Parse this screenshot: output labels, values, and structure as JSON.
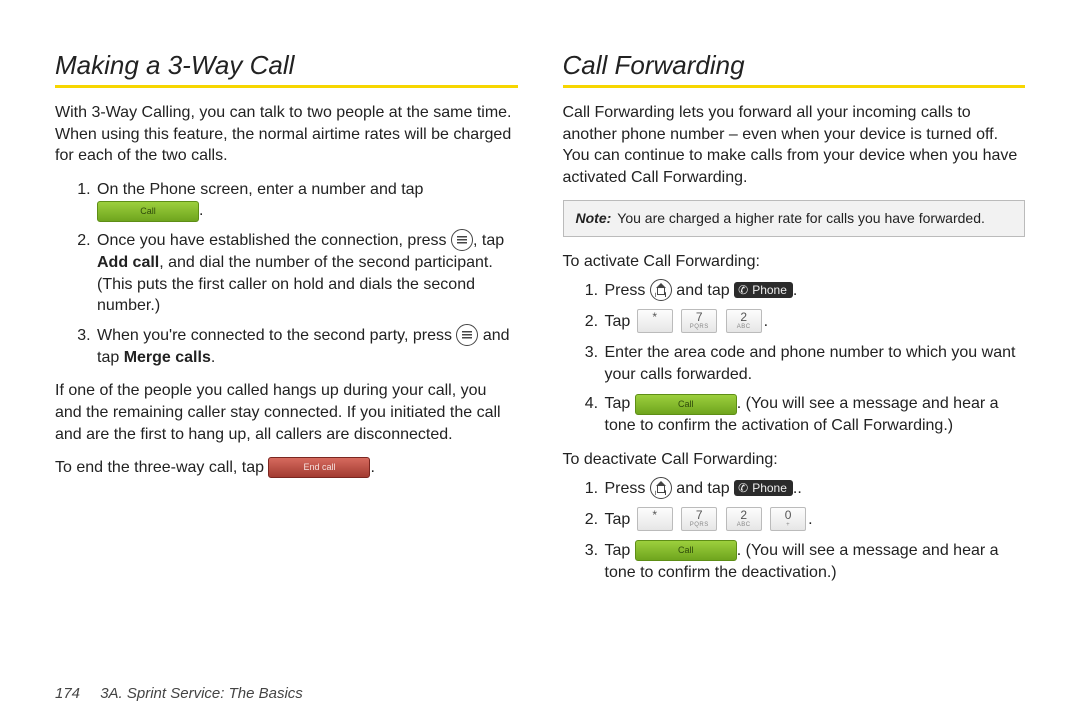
{
  "left": {
    "heading": "Making a 3-Way Call",
    "intro": "With 3-Way Calling, you can talk to two people at the same time. When using this feature, the normal airtime rates will be charged for each of the two calls.",
    "steps": {
      "s1a": "On the Phone screen, enter a number and tap ",
      "s1_btn": "Call",
      "s2a": "Once you have established the connection, press ",
      "s2b": ", tap ",
      "s2_bold": "Add call",
      "s2c": ", and dial the number of the second participant. (This puts the first caller on hold and dials the second number.)",
      "s3a": "When you're connected to the second party, press ",
      "s3b": " and tap ",
      "s3_bold": "Merge calls",
      "s3c": "."
    },
    "after": "If one of the people you called hangs up during your call, you and the remaining caller stay connected. If you initiated the call and are the first to hang up, all callers are disconnected.",
    "end_a": "To end the three-way call, tap ",
    "end_btn": "End call",
    "end_b": "."
  },
  "right": {
    "heading": "Call Forwarding",
    "intro": "Call Forwarding lets you forward all your incoming calls to another phone number – even when your device is turned off. You can continue to make calls from your device when you have activated Call Forwarding.",
    "note_label": "Note:",
    "note_text": "You are charged a higher rate for calls you have forwarded.",
    "activate_head": "To activate Call Forwarding:",
    "act": {
      "s1a": "Press ",
      "s1b": " and tap ",
      "phone_label": "Phone",
      "s1c": ".",
      "s2a": "Tap ",
      "s2b": ".",
      "s3": "Enter the area code and phone number to which you want your calls forwarded.",
      "s4a": "Tap ",
      "s4_btn": "Call",
      "s4b": ". (You will see a message and hear a tone to confirm the activation of Call Forwarding.)"
    },
    "deactivate_head": "To deactivate Call Forwarding:",
    "deact": {
      "s1a": "Press ",
      "s1b": " and tap ",
      "s1c": "..",
      "s2a": "Tap ",
      "s2b": ".",
      "s3a": "Tap ",
      "s3_btn": "Call",
      "s3b": ". (You will see a message and hear a tone to confirm the deactivation.)"
    },
    "keys_activate": [
      {
        "main": "*",
        "sub": ""
      },
      {
        "main": "7",
        "sub": "PQRS"
      },
      {
        "main": "2",
        "sub": "ABC"
      }
    ],
    "keys_deactivate": [
      {
        "main": "*",
        "sub": ""
      },
      {
        "main": "7",
        "sub": "PQRS"
      },
      {
        "main": "2",
        "sub": "ABC"
      },
      {
        "main": "0",
        "sub": "+"
      }
    ]
  },
  "footer": {
    "page": "174",
    "section": "3A. Sprint Service: The Basics"
  }
}
